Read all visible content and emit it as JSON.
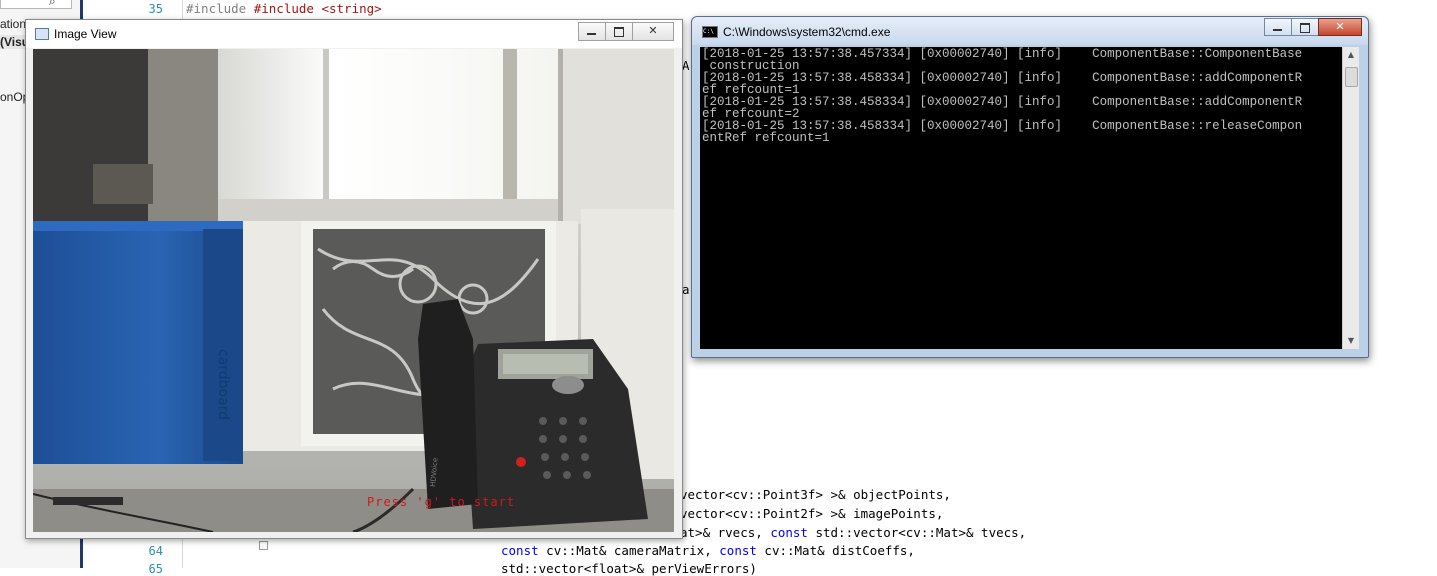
{
  "ide": {
    "left_panel_lines": [
      "ation'",
      "(Visu",
      "onOp"
    ],
    "line_numbers": {
      "top": "35",
      "n64": "64",
      "n65": "65"
    },
    "code_top": "#include <string>",
    "code_lines": {
      "l1": "vector<cv::Point3f> >& objectPoints,",
      "l2": "vector<cv::Point2f> >& imagePoints,",
      "l3_a": "at>& rvecs, ",
      "l3_kw": "const",
      "l3_b": " std::vector<cv::Mat>& tvecs,",
      "l4_kw1": "const",
      "l4_a": " cv::Mat& cameraMatrix, ",
      "l4_kw2": "const",
      "l4_b": " cv::Mat& distCoeffs,",
      "l5": "std::vector<float>& perViewErrors)"
    },
    "stray_chars": {
      "a1": "A",
      "a2": "a"
    }
  },
  "image_view": {
    "title": "Image View",
    "overlay_text": "Press 'g' to start",
    "phone_brand": "HDVoice"
  },
  "cmd": {
    "title": "C:\\Windows\\system32\\cmd.exe",
    "icon_text": "C:\\",
    "log_lines": [
      "[2018-01-25 13:57:38.457334] [0x00002740] [info]    ComponentBase::ComponentBase",
      " construction",
      "[2018-01-25 13:57:38.458334] [0x00002740] [info]    ComponentBase::addComponentR",
      "ef refcount=1",
      "[2018-01-25 13:57:38.458334] [0x00002740] [info]    ComponentBase::addComponentR",
      "ef refcount=2",
      "[2018-01-25 13:57:38.458334] [0x00002740] [info]    ComponentBase::releaseCompon",
      "entRef refcount=1"
    ]
  },
  "colors": {
    "console_bg": "#000000",
    "console_fg": "#c0c0c0",
    "overlay_text": "#d01818"
  }
}
